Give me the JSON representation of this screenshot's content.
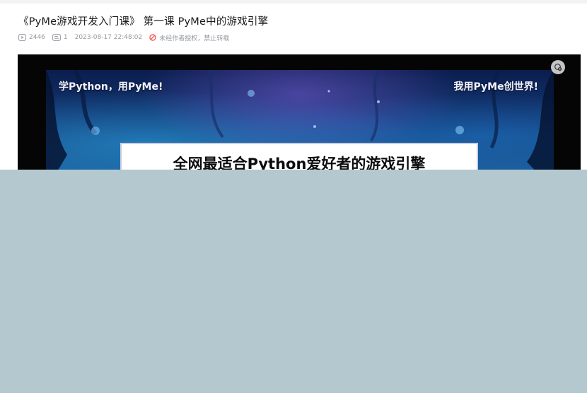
{
  "title": "《PyMe游戏开发入门课》 第一课 PyMe中的游戏引擎",
  "meta": {
    "views": "2446",
    "comments": "1",
    "datetime": "2023-08-17 22:48:02",
    "copyright": "未经作者授权，禁止转载",
    "view_icon": "play-count-icon",
    "comment_icon": "danmaku-icon",
    "forbid_icon": "forbidden-icon",
    "forbid_color": "#f25d59"
  },
  "video": {
    "caption_left": "学Python，用PyMe!",
    "caption_right": "我用PyMe创世界!",
    "headline": "全网最适合Python爱好者的游戏引擎",
    "corner_icon": "settings-icon"
  },
  "colors": {
    "overlay": "#b3c9cf",
    "title_text": "#18191c",
    "meta_text": "#9499a0"
  }
}
